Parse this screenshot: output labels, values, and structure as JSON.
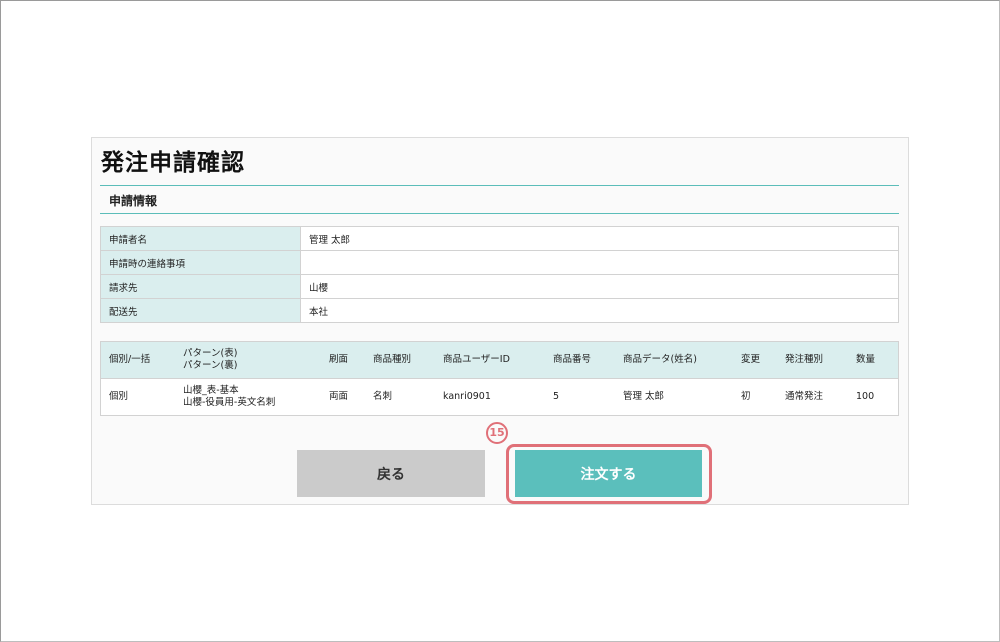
{
  "page": {
    "title": "発注申請確認",
    "section_title": "申請情報"
  },
  "info_rows": [
    {
      "label": "申請者名",
      "value": "管理 太郎"
    },
    {
      "label": "申請時の連絡事項",
      "value": ""
    },
    {
      "label": "請求先",
      "value": "山櫻"
    },
    {
      "label": "配送先",
      "value": "本社"
    }
  ],
  "items_table": {
    "headers": {
      "individual_bulk": "個別/一括",
      "pattern_front": "パターン(表)",
      "pattern_back": "パターン(裏)",
      "print_side": "刷面",
      "product_type": "商品種別",
      "product_user_id": "商品ユーザーID",
      "product_number": "商品番号",
      "product_data": "商品データ(姓名)",
      "change": "変更",
      "order_type": "発注種別",
      "quantity": "数量"
    },
    "rows": [
      {
        "individual_bulk": "個別",
        "pattern_front": "山櫻_表-基本",
        "pattern_back": "山櫻-役員用-英文名刺",
        "print_side": "両面",
        "product_type": "名刺",
        "product_user_id": "kanri0901",
        "product_number": "5",
        "product_data": "管理 太郎",
        "change": "初",
        "order_type": "通常発注",
        "quantity": "100"
      }
    ]
  },
  "buttons": {
    "back_label": "戻る",
    "order_label": "注文する"
  },
  "annotation": {
    "step_number": "15"
  },
  "colors": {
    "accent": "#5bbfbc",
    "header_bg": "#daeeee",
    "highlight": "#e07078",
    "back_button": "#cbcbcb"
  }
}
